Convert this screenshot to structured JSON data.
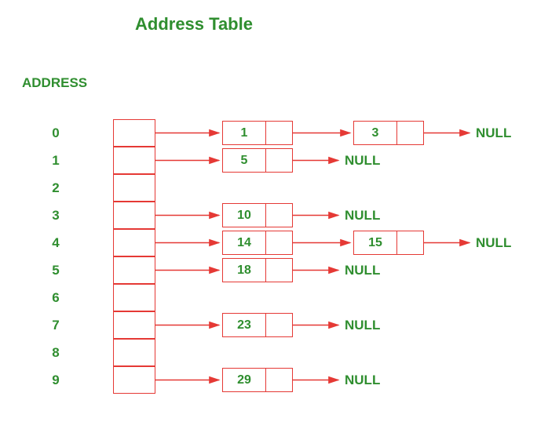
{
  "title": "Address Table",
  "header": "ADDRESS",
  "null_label": "NULL",
  "buckets": [
    {
      "index": "0",
      "chain": [
        "1",
        "3"
      ]
    },
    {
      "index": "1",
      "chain": [
        "5"
      ]
    },
    {
      "index": "2",
      "chain": []
    },
    {
      "index": "3",
      "chain": [
        "10"
      ]
    },
    {
      "index": "4",
      "chain": [
        "14",
        "15"
      ]
    },
    {
      "index": "5",
      "chain": [
        "18"
      ]
    },
    {
      "index": "6",
      "chain": []
    },
    {
      "index": "7",
      "chain": [
        "23"
      ]
    },
    {
      "index": "8",
      "chain": []
    },
    {
      "index": "9",
      "chain": [
        "29"
      ]
    }
  ],
  "colors": {
    "accent": "#e53935",
    "text": "#2f8e2f"
  }
}
